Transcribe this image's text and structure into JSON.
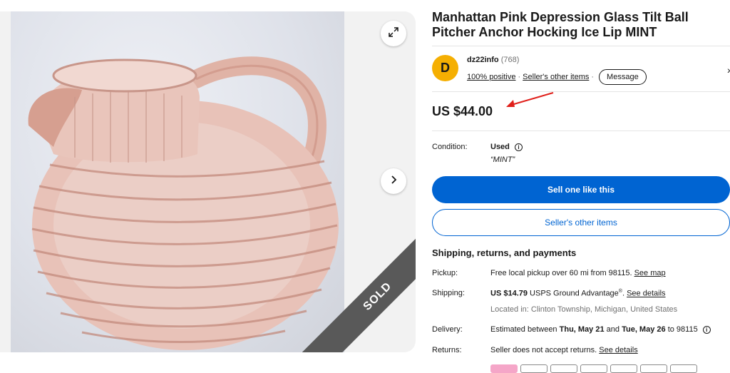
{
  "listing": {
    "title": "Manhattan Pink Depression Glass Tilt Ball Pitcher Anchor Hocking Ice Lip MINT",
    "price": "US $44.00",
    "sold_badge": "SOLD"
  },
  "seller": {
    "avatar_letter": "D",
    "name": "dz22info",
    "feedback_count": "(768)",
    "positive": "100% positive",
    "other_items": "Seller's other items",
    "message_label": "Message"
  },
  "condition": {
    "label": "Condition:",
    "value": "Used",
    "note": "“MINT”"
  },
  "buttons": {
    "sell_one": "Sell one like this",
    "other_items": "Seller's other items"
  },
  "shipping": {
    "section_title": "Shipping, returns, and payments",
    "pickup_label": "Pickup:",
    "pickup_value": "Free local pickup over 60 mi from 98115.",
    "pickup_link": "See map",
    "shipping_label": "Shipping:",
    "shipping_price": "US $14.79",
    "shipping_service": "USPS Ground Advantage",
    "shipping_reg": "®",
    "shipping_link": "See details",
    "location": "Located in: Clinton Township, Michigan, United States",
    "delivery_label": "Delivery:",
    "delivery_prefix": "Estimated between",
    "delivery_start": "Thu, May 21",
    "delivery_and": "and",
    "delivery_end": "Tue, May 26",
    "delivery_to": "to 98115",
    "returns_label": "Returns:",
    "returns_value": "Seller does not accept returns.",
    "returns_link": "See details"
  },
  "colors": {
    "primary": "#0064d2",
    "avatar": "#f5af02",
    "annotation_arrow": "#e0201b",
    "sold_band": "#595959"
  },
  "icons": [
    "expand-icon",
    "chevron-right-icon",
    "info-icon",
    "arrow-annotation-icon"
  ]
}
